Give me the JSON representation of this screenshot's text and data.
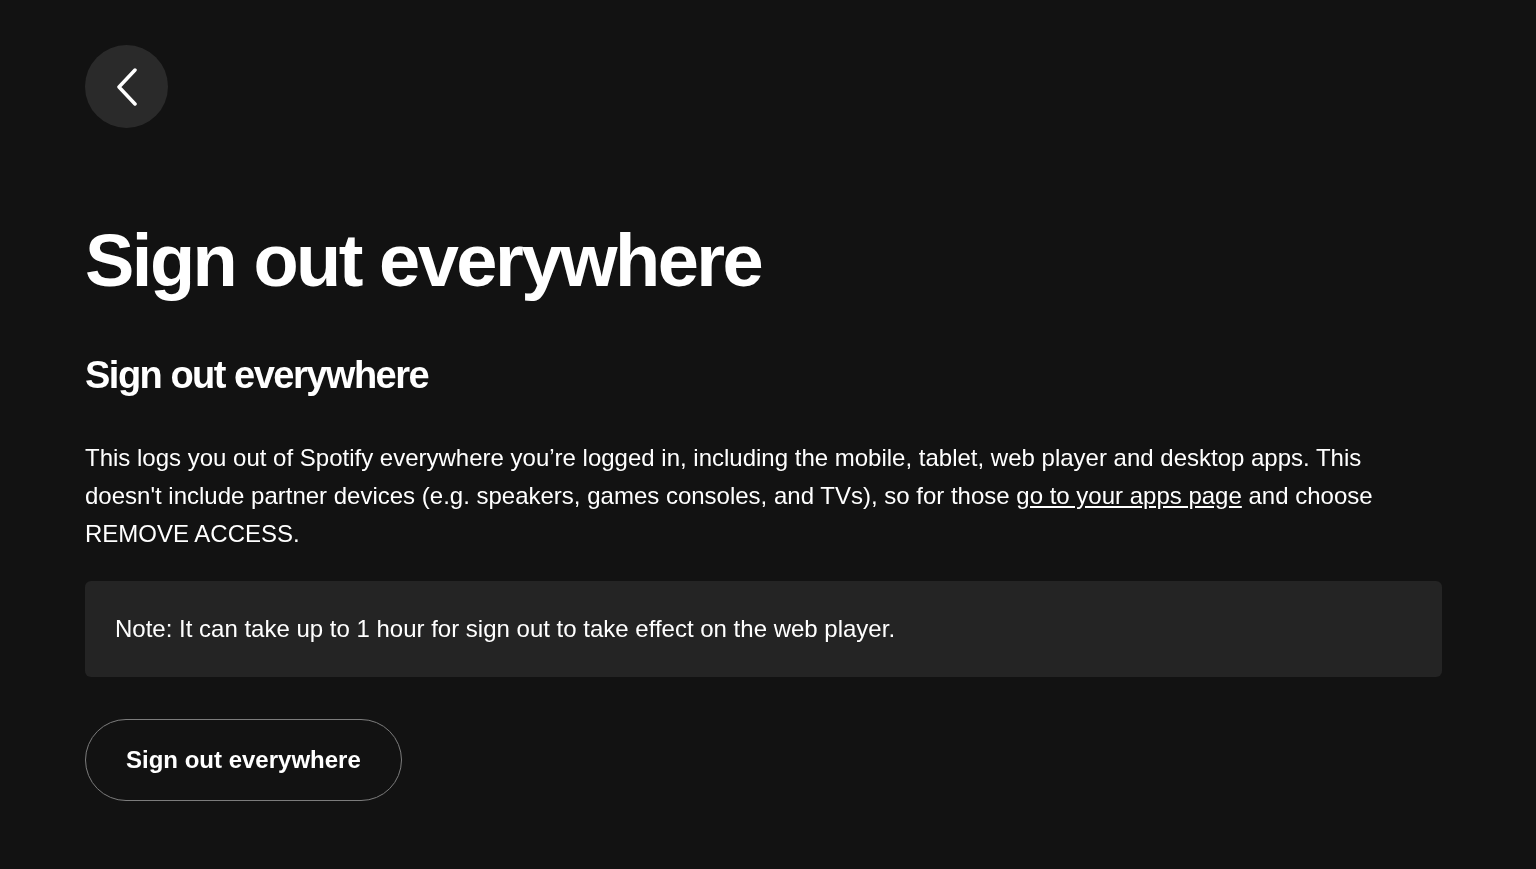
{
  "page_title": "Sign out everywhere",
  "section": {
    "heading": "Sign out everywhere",
    "description": {
      "text_before": "This logs you out of Spotify everywhere you’re logged in, including the mobile, tablet, web player and desktop apps. This doesn't include partner devices (e.g. speakers, games consoles, and TVs), so for those ",
      "link": "go to your apps page",
      "text_after": " and choose REMOVE ACCESS."
    },
    "note": "Note: It can take up to 1 hour for sign out to take effect on the web player.",
    "button": "Sign out everywhere"
  }
}
